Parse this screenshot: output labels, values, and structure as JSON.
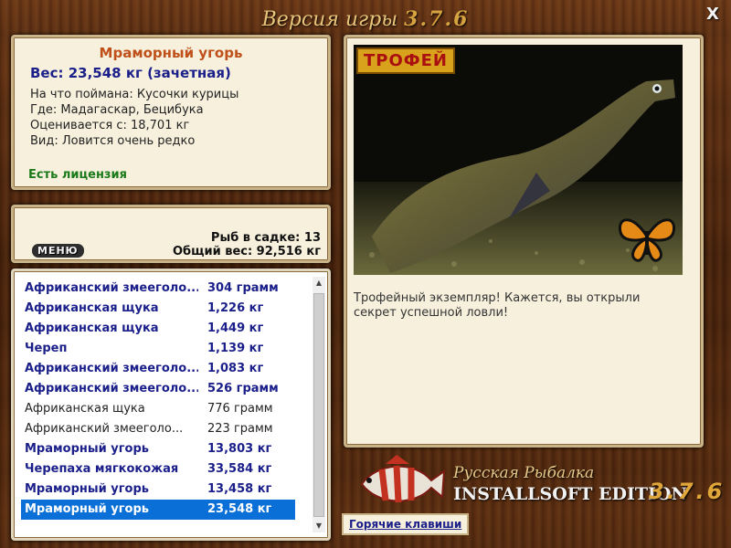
{
  "window": {
    "title_prefix": "Версия игры",
    "title_version": "3.7.6",
    "close_label": "X"
  },
  "info": {
    "fish_name": "Мраморный угорь",
    "weight": "Вес: 23,548 кг (зачетная)",
    "bait": "На что поймана: Кусочки курицы",
    "location": "Где: Мадагаскар, Бецибука",
    "value": "Оценивается с: 18,701 кг",
    "rarity": "Вид: Ловится очень редко",
    "license": "Есть лицензия"
  },
  "cage": {
    "menu_label": "МЕНЮ",
    "fish_count": "Рыб в садке: 13",
    "total_weight": "Общий вес: 92,516 кг"
  },
  "catch_list": [
    {
      "name": "Африканский змееголо...",
      "weight": "304 грамм",
      "style": "bold"
    },
    {
      "name": "Африканская щука",
      "weight": "1,226 кг",
      "style": "bold"
    },
    {
      "name": "Африканская щука",
      "weight": "1,449 кг",
      "style": "bold"
    },
    {
      "name": "Череп",
      "weight": "1,139 кг",
      "style": "bold"
    },
    {
      "name": "Африканский змееголо...",
      "weight": "1,083 кг",
      "style": "bold"
    },
    {
      "name": "Африканский змееголо...",
      "weight": "526 грамм",
      "style": "bold"
    },
    {
      "name": "Африканская щука",
      "weight": "776 грамм",
      "style": "plain"
    },
    {
      "name": "Африканский змееголо...",
      "weight": "223 грамм",
      "style": "plain"
    },
    {
      "name": "Мраморный угорь",
      "weight": "13,803 кг",
      "style": "bold"
    },
    {
      "name": "Черепаха мягкокожая",
      "weight": "33,584 кг",
      "style": "bold"
    },
    {
      "name": "Мраморный угорь",
      "weight": "13,458 кг",
      "style": "bold"
    },
    {
      "name": "Мраморный угорь",
      "weight": "23,548 кг",
      "style": "sel"
    }
  ],
  "photo": {
    "badge": "ТРОФЕЙ",
    "description": "Трофейный экземпляр! Кажется, вы открыли секрет успешной ловли!"
  },
  "branding": {
    "line1": "Русская Рыбалка",
    "line2": "INSTALLSOFT EDITION",
    "version": "3.7.6"
  },
  "hotkeys_label": "Горячие клавиши",
  "colors": {
    "accent": "#0a6fd6",
    "trophy_badge": "#d8a21c",
    "fish_name": "#c0501a",
    "bold_text": "#1b1f8a"
  }
}
